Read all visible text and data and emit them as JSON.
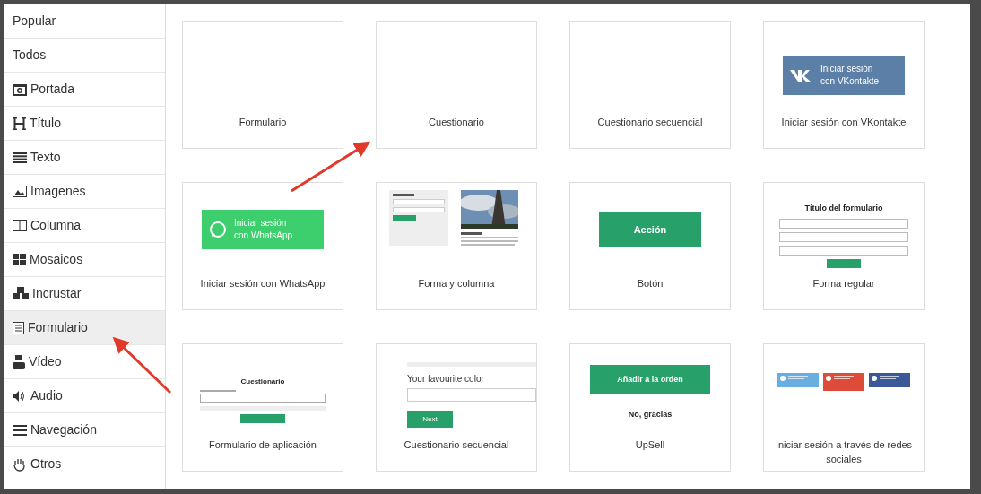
{
  "sidebar": {
    "items": [
      {
        "label": "Popular",
        "selected": false
      },
      {
        "label": "Todos",
        "selected": false
      },
      {
        "label": "Portada",
        "selected": false
      },
      {
        "label": "Título",
        "selected": false
      },
      {
        "label": "Texto",
        "selected": false
      },
      {
        "label": "Imagenes",
        "selected": false
      },
      {
        "label": "Columna",
        "selected": false
      },
      {
        "label": "Mosaicos",
        "selected": false
      },
      {
        "label": "Incrustar",
        "selected": false
      },
      {
        "label": "Formulario",
        "selected": true
      },
      {
        "label": "Vídeo",
        "selected": false
      },
      {
        "label": "Audio",
        "selected": false
      },
      {
        "label": "Navegación",
        "selected": false
      },
      {
        "label": "Otros",
        "selected": false
      }
    ]
  },
  "templates": [
    {
      "label": "Formulario",
      "preview": {
        "kind": "blank"
      }
    },
    {
      "label": "Cuestionario",
      "preview": {
        "kind": "blank"
      }
    },
    {
      "label": "Cuestionario secuencial",
      "preview": {
        "kind": "blank"
      }
    },
    {
      "label": "Iniciar sesión con VKontakte",
      "preview": {
        "kind": "vk",
        "text": "Iniciar sesión\ncon VKontakte"
      }
    },
    {
      "label": "Iniciar sesión con WhatsApp",
      "preview": {
        "kind": "whatsapp",
        "text": "Iniciar sesión\ncon WhatsApp"
      }
    },
    {
      "label": "Forma y columna",
      "preview": {
        "kind": "form_column"
      }
    },
    {
      "label": "Botón",
      "preview": {
        "kind": "button",
        "text": "Acción"
      }
    },
    {
      "label": "Forma regular",
      "preview": {
        "kind": "regular_form",
        "title": "Título del formulario"
      }
    },
    {
      "label": "Formulario de aplicación",
      "preview": {
        "kind": "app_form",
        "title": "Cuestionario"
      }
    },
    {
      "label": "Cuestionario secuencial",
      "preview": {
        "kind": "sequential",
        "question": "Your favourite color",
        "button": "Next"
      }
    },
    {
      "label": "UpSell",
      "preview": {
        "kind": "upsell",
        "button": "Añadir a la orden",
        "decline": "No, gracias"
      }
    },
    {
      "label": "Iniciar sesión a través de redes sociales",
      "preview": {
        "kind": "social"
      }
    }
  ]
}
